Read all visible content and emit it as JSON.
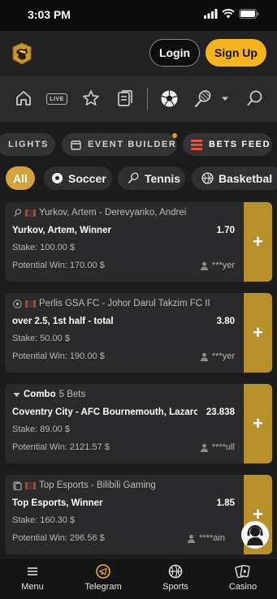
{
  "status_bar": {
    "time": "3:03 PM"
  },
  "header": {
    "login_label": "Login",
    "signup_label": "Sign Up"
  },
  "nav": {
    "live_label": "LIVE"
  },
  "quick_tabs": [
    {
      "label": "LIGHTS"
    },
    {
      "label": "EVENT BUILDER"
    },
    {
      "label": "BETS FEED"
    }
  ],
  "sports": [
    {
      "label": "All"
    },
    {
      "label": "Soccer"
    },
    {
      "label": "Tennis"
    },
    {
      "label": "Basketbal"
    }
  ],
  "bets": [
    {
      "event": "Yurkov, Artem - Derevyanko, Andrei",
      "selection": "Yurkov, Artem, Winner",
      "odds": "1.70",
      "stake": "Stake: 100.00 $",
      "potential_win": "Potential Win: 170.00 $",
      "user": "***yer",
      "add_label": "+"
    },
    {
      "event": "Perlis GSA FC - Johor Darul Takzim FC II",
      "selection": "over 2.5, 1st half - total",
      "odds": "3.80",
      "stake": "Stake: 50.00 $",
      "potential_win": "Potential Win: 190.00 $",
      "user": "***yer",
      "add_label": "+"
    },
    {
      "combo_title": "Combo",
      "combo_count": "5 Bets",
      "selection": "Coventry City - AFC Bournemouth, Lazaro",
      "odds": "23.838",
      "stake": "Stake: 89.00 $",
      "potential_win": "Potential Win: 2121.57 $",
      "user": "****ull",
      "add_label": "+"
    },
    {
      "event": "Top Esports - Bilibili Gaming",
      "selection": "Top Esports, Winner",
      "odds": "1.85",
      "stake": "Stake: 160.30 $",
      "potential_win": "Potential Win: 296.56 $",
      "user": "****ain",
      "add_label": "+"
    }
  ],
  "bottom_nav": [
    {
      "label": "Menu"
    },
    {
      "label": "Telegram"
    },
    {
      "label": "Sports"
    },
    {
      "label": "Casino"
    }
  ],
  "colors": {
    "accent": "#f5b41e",
    "card_add": "#b8902a",
    "all_chip": "#d4a23a"
  }
}
